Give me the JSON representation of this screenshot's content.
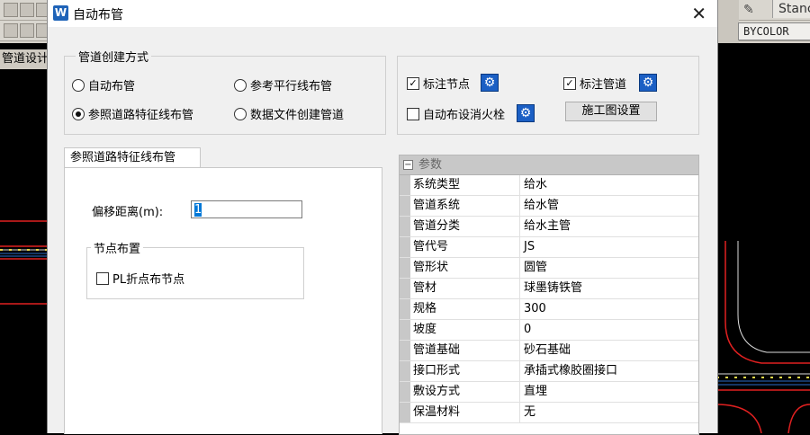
{
  "cad": {
    "style_name": "Stanc",
    "color_value": "BYCOLOR",
    "tab_label": "管道设计"
  },
  "dialog": {
    "title": "自动布管",
    "close_glyph": "✕",
    "icon_glyph": "W"
  },
  "create_mode": {
    "group_title": "管道创建方式",
    "options": [
      {
        "label": "自动布管",
        "selected": false
      },
      {
        "label": "参考平行线布管",
        "selected": false
      },
      {
        "label": "参照道路特征线布管",
        "selected": true
      },
      {
        "label": "数据文件创建管道",
        "selected": false
      }
    ]
  },
  "annotations": {
    "mark_nodes": {
      "label": "标注节点",
      "checked": true
    },
    "mark_pipes": {
      "label": "标注管道",
      "checked": true
    },
    "auto_hydrant": {
      "label": "自动布设消火栓",
      "checked": false
    },
    "construction_button": "施工图设置",
    "check_glyph": "✓",
    "gear_glyph": "⚙"
  },
  "road_tab": {
    "tab_label": "参照道路特征线布管",
    "offset_label": "偏移距离(m):",
    "offset_value": "1",
    "node_group_title": "节点布置",
    "pl_checkbox_label": "PL折点布节点",
    "pl_checked": false
  },
  "params": {
    "header": "参数",
    "expander_glyph": "−",
    "rows": [
      {
        "name": "系统类型",
        "value": "给水"
      },
      {
        "name": "管道系统",
        "value": "给水管"
      },
      {
        "name": "管道分类",
        "value": "给水主管"
      },
      {
        "name": "管代号",
        "value": "JS"
      },
      {
        "name": "管形状",
        "value": "圆管"
      },
      {
        "name": "管材",
        "value": "球墨铸铁管"
      },
      {
        "name": "规格",
        "value": "300"
      },
      {
        "name": "坡度",
        "value": "0"
      },
      {
        "name": "管道基础",
        "value": "砂石基础"
      },
      {
        "name": "接口形式",
        "value": "承插式橡胶圈接口"
      },
      {
        "name": "敷设方式",
        "value": "直埋"
      },
      {
        "name": "保温材料",
        "value": "无"
      }
    ]
  },
  "colors": {
    "accent_blue": "#1b5fc4",
    "cad_road_red": "#e02020",
    "cad_road_yellow": "#e8d84a"
  }
}
